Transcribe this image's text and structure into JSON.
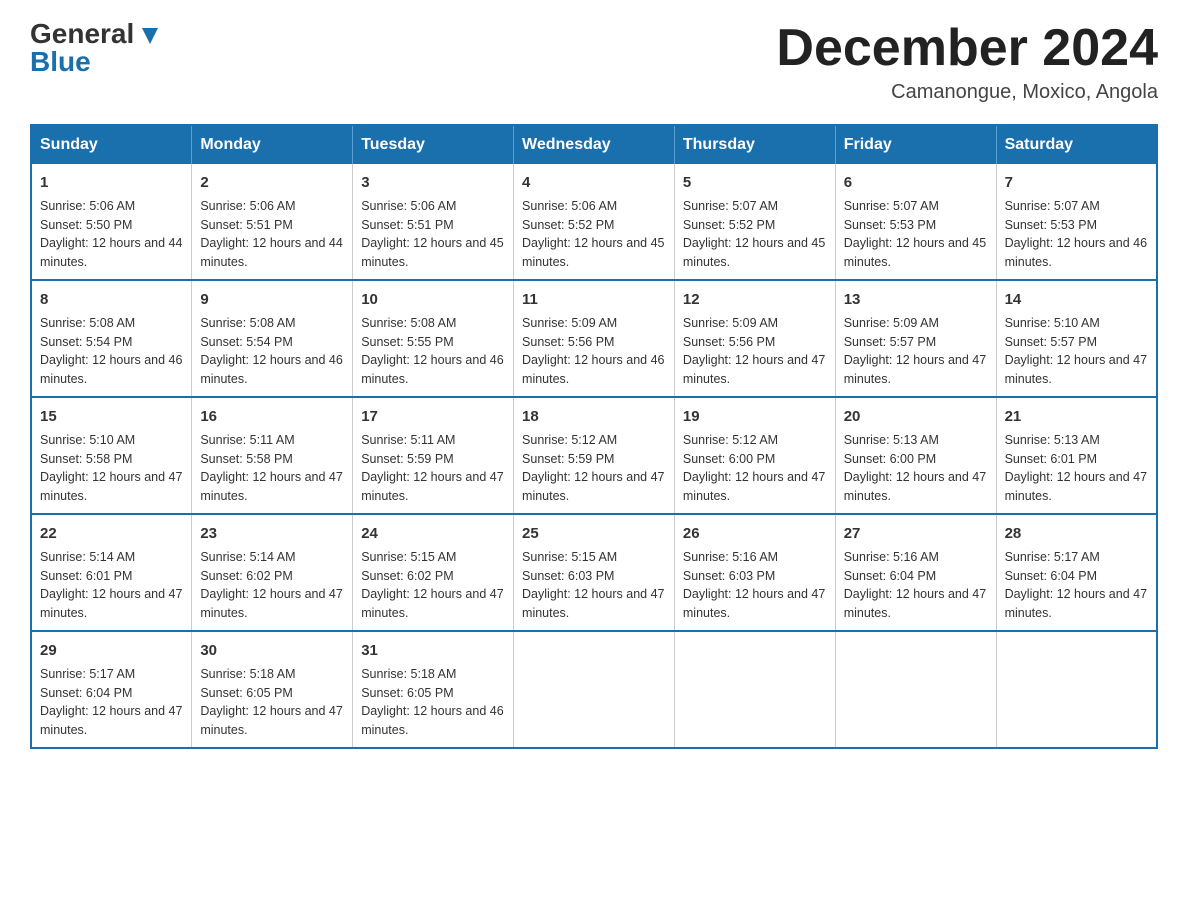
{
  "logo": {
    "general": "General",
    "blue": "Blue"
  },
  "header": {
    "month": "December 2024",
    "location": "Camanongue, Moxico, Angola"
  },
  "days_of_week": [
    "Sunday",
    "Monday",
    "Tuesday",
    "Wednesday",
    "Thursday",
    "Friday",
    "Saturday"
  ],
  "weeks": [
    [
      {
        "day": "1",
        "sunrise": "5:06 AM",
        "sunset": "5:50 PM",
        "daylight": "12 hours and 44 minutes."
      },
      {
        "day": "2",
        "sunrise": "5:06 AM",
        "sunset": "5:51 PM",
        "daylight": "12 hours and 44 minutes."
      },
      {
        "day": "3",
        "sunrise": "5:06 AM",
        "sunset": "5:51 PM",
        "daylight": "12 hours and 45 minutes."
      },
      {
        "day": "4",
        "sunrise": "5:06 AM",
        "sunset": "5:52 PM",
        "daylight": "12 hours and 45 minutes."
      },
      {
        "day": "5",
        "sunrise": "5:07 AM",
        "sunset": "5:52 PM",
        "daylight": "12 hours and 45 minutes."
      },
      {
        "day": "6",
        "sunrise": "5:07 AM",
        "sunset": "5:53 PM",
        "daylight": "12 hours and 45 minutes."
      },
      {
        "day": "7",
        "sunrise": "5:07 AM",
        "sunset": "5:53 PM",
        "daylight": "12 hours and 46 minutes."
      }
    ],
    [
      {
        "day": "8",
        "sunrise": "5:08 AM",
        "sunset": "5:54 PM",
        "daylight": "12 hours and 46 minutes."
      },
      {
        "day": "9",
        "sunrise": "5:08 AM",
        "sunset": "5:54 PM",
        "daylight": "12 hours and 46 minutes."
      },
      {
        "day": "10",
        "sunrise": "5:08 AM",
        "sunset": "5:55 PM",
        "daylight": "12 hours and 46 minutes."
      },
      {
        "day": "11",
        "sunrise": "5:09 AM",
        "sunset": "5:56 PM",
        "daylight": "12 hours and 46 minutes."
      },
      {
        "day": "12",
        "sunrise": "5:09 AM",
        "sunset": "5:56 PM",
        "daylight": "12 hours and 47 minutes."
      },
      {
        "day": "13",
        "sunrise": "5:09 AM",
        "sunset": "5:57 PM",
        "daylight": "12 hours and 47 minutes."
      },
      {
        "day": "14",
        "sunrise": "5:10 AM",
        "sunset": "5:57 PM",
        "daylight": "12 hours and 47 minutes."
      }
    ],
    [
      {
        "day": "15",
        "sunrise": "5:10 AM",
        "sunset": "5:58 PM",
        "daylight": "12 hours and 47 minutes."
      },
      {
        "day": "16",
        "sunrise": "5:11 AM",
        "sunset": "5:58 PM",
        "daylight": "12 hours and 47 minutes."
      },
      {
        "day": "17",
        "sunrise": "5:11 AM",
        "sunset": "5:59 PM",
        "daylight": "12 hours and 47 minutes."
      },
      {
        "day": "18",
        "sunrise": "5:12 AM",
        "sunset": "5:59 PM",
        "daylight": "12 hours and 47 minutes."
      },
      {
        "day": "19",
        "sunrise": "5:12 AM",
        "sunset": "6:00 PM",
        "daylight": "12 hours and 47 minutes."
      },
      {
        "day": "20",
        "sunrise": "5:13 AM",
        "sunset": "6:00 PM",
        "daylight": "12 hours and 47 minutes."
      },
      {
        "day": "21",
        "sunrise": "5:13 AM",
        "sunset": "6:01 PM",
        "daylight": "12 hours and 47 minutes."
      }
    ],
    [
      {
        "day": "22",
        "sunrise": "5:14 AM",
        "sunset": "6:01 PM",
        "daylight": "12 hours and 47 minutes."
      },
      {
        "day": "23",
        "sunrise": "5:14 AM",
        "sunset": "6:02 PM",
        "daylight": "12 hours and 47 minutes."
      },
      {
        "day": "24",
        "sunrise": "5:15 AM",
        "sunset": "6:02 PM",
        "daylight": "12 hours and 47 minutes."
      },
      {
        "day": "25",
        "sunrise": "5:15 AM",
        "sunset": "6:03 PM",
        "daylight": "12 hours and 47 minutes."
      },
      {
        "day": "26",
        "sunrise": "5:16 AM",
        "sunset": "6:03 PM",
        "daylight": "12 hours and 47 minutes."
      },
      {
        "day": "27",
        "sunrise": "5:16 AM",
        "sunset": "6:04 PM",
        "daylight": "12 hours and 47 minutes."
      },
      {
        "day": "28",
        "sunrise": "5:17 AM",
        "sunset": "6:04 PM",
        "daylight": "12 hours and 47 minutes."
      }
    ],
    [
      {
        "day": "29",
        "sunrise": "5:17 AM",
        "sunset": "6:04 PM",
        "daylight": "12 hours and 47 minutes."
      },
      {
        "day": "30",
        "sunrise": "5:18 AM",
        "sunset": "6:05 PM",
        "daylight": "12 hours and 47 minutes."
      },
      {
        "day": "31",
        "sunrise": "5:18 AM",
        "sunset": "6:05 PM",
        "daylight": "12 hours and 46 minutes."
      },
      null,
      null,
      null,
      null
    ]
  ],
  "colors": {
    "header_bg": "#1a6fad",
    "border": "#1a6fad"
  }
}
